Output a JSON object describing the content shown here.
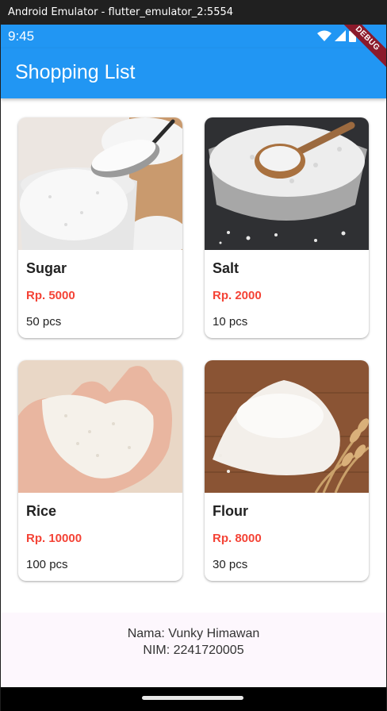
{
  "window": {
    "title": "Android Emulator - flutter_emulator_2:5554"
  },
  "status_bar": {
    "time": "9:45",
    "icons": [
      "wifi-icon",
      "cell-signal-icon",
      "battery-icon"
    ]
  },
  "debug_banner": "DEBUG",
  "app_bar": {
    "title": "Shopping List",
    "color": "#2196f3"
  },
  "items": [
    {
      "name": "Sugar",
      "price": "Rp. 5000",
      "qty": "50 pcs",
      "image": "sugar-bowl-spoon"
    },
    {
      "name": "Salt",
      "price": "Rp. 2000",
      "qty": "10 pcs",
      "image": "salt-bowl-wooden-spoon"
    },
    {
      "name": "Rice",
      "price": "Rp. 10000",
      "qty": "100 pcs",
      "image": "rice-in-hands"
    },
    {
      "name": "Flour",
      "price": "Rp. 8000",
      "qty": "30 pcs",
      "image": "flour-pile-wheat"
    }
  ],
  "footer": {
    "nama": "Nama: Vunky Himawan",
    "nim": "NIM: 2241720005"
  },
  "colors": {
    "price": "#f44336",
    "footer_bg": "#fdf7fd"
  }
}
